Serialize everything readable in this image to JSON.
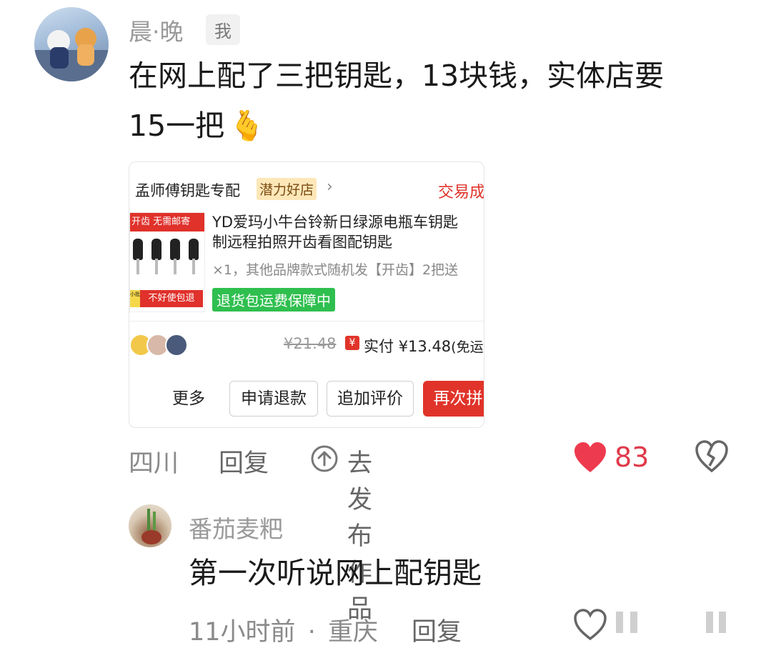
{
  "comment1": {
    "username": "晨·晚",
    "badge": "我",
    "text_line1": "在网上配了三把钥匙，13块钱，实体店要",
    "text_line2": "15一把",
    "emoji": "🫰",
    "location": "四川",
    "reply_label": "回复",
    "publish_label": "去发布作品",
    "like_count": "83"
  },
  "order_card": {
    "shop_name": "孟师傅钥匙专配",
    "shop_badge": "潜力好店",
    "status": "交易成",
    "thumb_top_text": "开齿  无需邮寄",
    "thumb_bottom_text": "不好使包退",
    "thumb_side_text": "小批",
    "product_title_line1": "YD爱玛小牛台铃新日绿源电瓶车钥匙",
    "product_title_line2": "制远程拍照开齿看图配钥匙",
    "product_spec": "×1，其他品牌款式随机发【开齿】2把送",
    "guarantee": "退货包运费保障中",
    "original_price": "¥21.48",
    "paid_icon": "¥",
    "paid_label": "实付",
    "paid_amount": "¥13.48",
    "paid_note": "(免运",
    "buttons": {
      "more": "更多",
      "refund": "申请退款",
      "review": "追加评价",
      "rebuy": "再次拼"
    }
  },
  "comment2": {
    "username": "番茄麦粑",
    "text": "第一次听说网上配钥匙",
    "time": "11小时前",
    "separator": "·",
    "location": "重庆",
    "reply_label": "回复"
  },
  "colors": {
    "accent_red": "#e0342a",
    "like_red": "#ee3a4e",
    "guarantee_green": "#2fbf4f"
  }
}
